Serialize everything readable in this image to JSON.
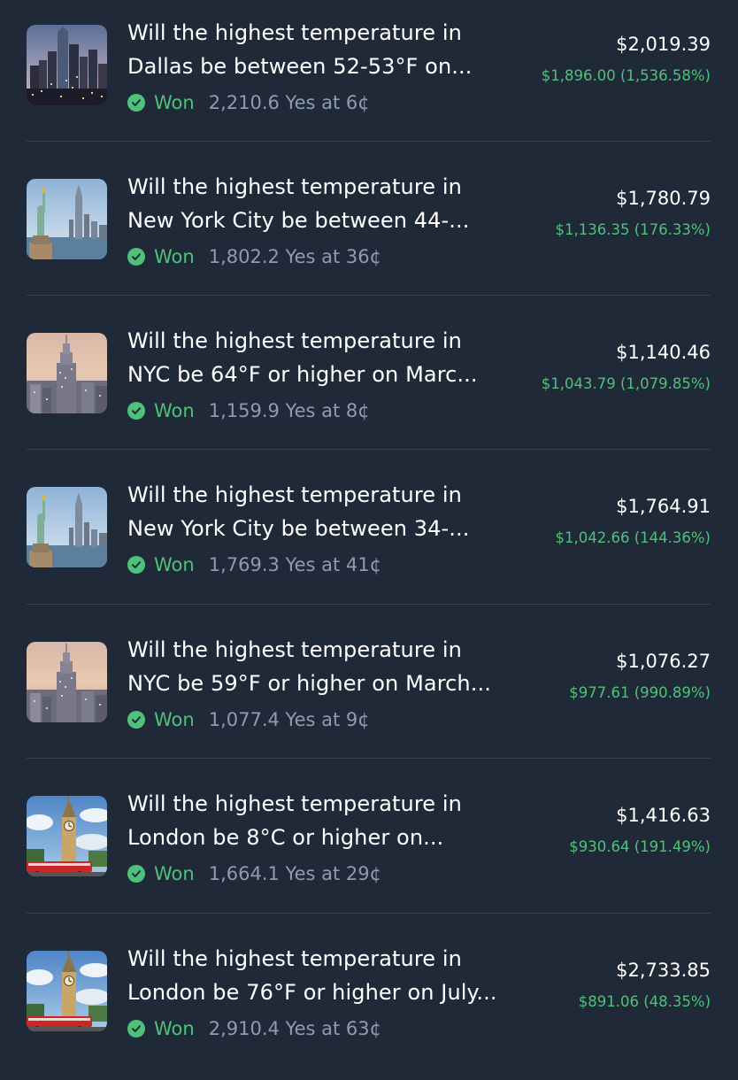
{
  "positions": [
    {
      "title_line1": "Will the highest temperature in",
      "title_line2": "Dallas be between 52-53°F on...",
      "status": "Won",
      "shares": "2,210.6 Yes at 6¢",
      "value": "$2,019.39",
      "pnl": "$1,896.00 (1,536.58%)",
      "thumbnail_icon": "dallas-skyline-image"
    },
    {
      "title_line1": "Will the highest temperature in",
      "title_line2": "New York City be between 44-...",
      "status": "Won",
      "shares": "1,802.2 Yes at 36¢",
      "value": "$1,780.79",
      "pnl": "$1,136.35 (176.33%)",
      "thumbnail_icon": "statue-of-liberty-image"
    },
    {
      "title_line1": "Will the highest temperature in",
      "title_line2": "NYC be 64°F or higher on Marc...",
      "status": "Won",
      "shares": "1,159.9 Yes at 8¢",
      "value": "$1,140.46",
      "pnl": "$1,043.79 (1,079.85%)",
      "thumbnail_icon": "empire-state-building-image"
    },
    {
      "title_line1": "Will the highest temperature in",
      "title_line2": "New York City be between 34-...",
      "status": "Won",
      "shares": "1,769.3 Yes at 41¢",
      "value": "$1,764.91",
      "pnl": "$1,042.66 (144.36%)",
      "thumbnail_icon": "statue-of-liberty-image"
    },
    {
      "title_line1": "Will the highest temperature in",
      "title_line2": "NYC be 59°F or higher on March...",
      "status": "Won",
      "shares": "1,077.4 Yes at 9¢",
      "value": "$1,076.27",
      "pnl": "$977.61 (990.89%)",
      "thumbnail_icon": "empire-state-building-image"
    },
    {
      "title_line1": "Will the highest temperature in",
      "title_line2": "London be 8°C or higher on...",
      "status": "Won",
      "shares": "1,664.1 Yes at 29¢",
      "value": "$1,416.63",
      "pnl": "$930.64 (191.49%)",
      "thumbnail_icon": "big-ben-image"
    },
    {
      "title_line1": "Will the highest temperature in",
      "title_line2": "London be 76°F or higher on July...",
      "status": "Won",
      "shares": "2,910.4 Yes at 63¢",
      "value": "$2,733.85",
      "pnl": "$891.06 (48.35%)",
      "thumbnail_icon": "big-ben-image"
    }
  ],
  "colors": {
    "background": "#1f2937",
    "divider": "#364152",
    "won_green": "#4ec27a",
    "muted_text": "#8f9bae",
    "primary_text": "#ffffff"
  }
}
